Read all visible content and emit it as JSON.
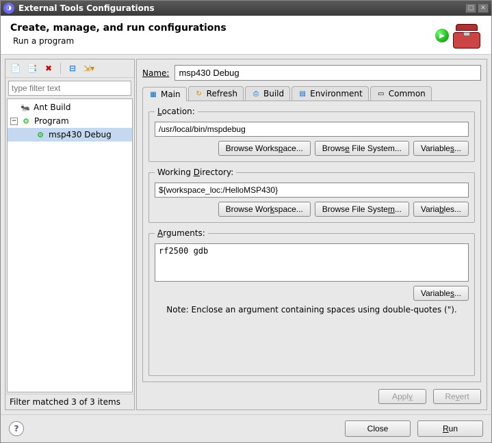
{
  "window": {
    "title": "External Tools Configurations"
  },
  "header": {
    "title": "Create, manage, and run configurations",
    "subtitle": "Run a program"
  },
  "left": {
    "filter_placeholder": "type filter text",
    "tree": {
      "ant_build": "Ant Build",
      "program": "Program",
      "msp430": "msp430 Debug"
    },
    "filter_status": "Filter matched 3 of 3 items"
  },
  "form": {
    "name_label": "Name:",
    "name_value": "msp430 Debug",
    "tabs": {
      "main": "Main",
      "refresh": "Refresh",
      "build": "Build",
      "environment": "Environment",
      "common": "Common"
    },
    "location": {
      "legend": "Location:",
      "value": "/usr/local/bin/mspdebug",
      "browse_ws": "Browse Workspace...",
      "browse_fs": "Browse File System...",
      "variables": "Variables..."
    },
    "working_dir": {
      "legend": "Working Directory:",
      "value": "${workspace_loc:/HelloMSP430}",
      "browse_ws": "Browse Workspace...",
      "browse_fs": "Browse File System...",
      "variables": "Variables..."
    },
    "arguments": {
      "legend": "Arguments:",
      "value": "rf2500 gdb",
      "variables": "Variables...",
      "note": "Note: Enclose an argument containing spaces using double-quotes (\")."
    },
    "apply": "Apply",
    "revert": "Revert"
  },
  "footer": {
    "close": "Close",
    "run": "Run"
  }
}
